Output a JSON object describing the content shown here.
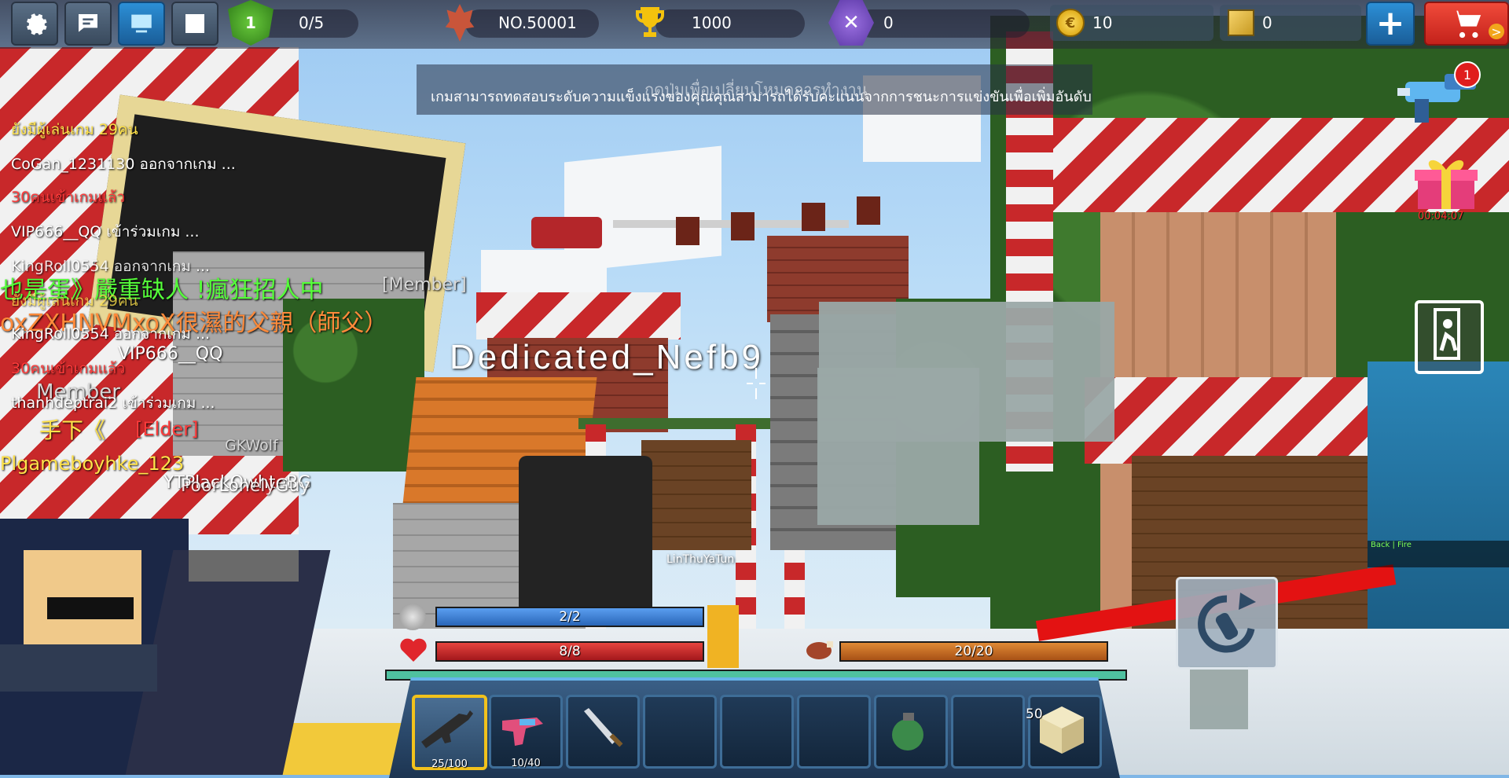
{
  "topbar": {
    "buttons": [
      {
        "name": "settings-button",
        "icon": "gear-icon"
      },
      {
        "name": "chat-button",
        "icon": "chat-bubble-icon"
      },
      {
        "name": "screen-button",
        "icon": "monitor-icon"
      },
      {
        "name": "emote-button",
        "icon": "face-icon"
      }
    ],
    "level": "1",
    "kills": "0/5",
    "rank": "NO.50001",
    "trophies": "1000",
    "tools": "0",
    "gold": "10",
    "cubes": "0",
    "add_icon": "plus-icon",
    "shop_icon": "cart-icon",
    "shop_arrow": ">"
  },
  "banner": {
    "line1": "กดปุ่มเพื่อเปลี่ยนโหมดการทำงาน",
    "line2": "เกมสามารถทดสอบระดับความแข็งแรงของคุณคุณสามารถได้รับคะแนนจากการชนะการแข่งขันเพื่อเพิ่มอันดับ"
  },
  "chat": [
    {
      "text": "ยังมีผู้เล่นเกม 29คน",
      "color": "#ffe24a"
    },
    {
      "text": "CoGan_1231130 ออกจากเกม ...",
      "color": "#ffffff"
    },
    {
      "text": "30คนเข้าเกมแล้ว",
      "color": "#ff3b3b"
    },
    {
      "text": "VIP666__QQ เข้าร่วมเกม ...",
      "color": "#ffffff"
    },
    {
      "text": "KingRoll0554 ออกจากเกม ...",
      "color": "#ffffff"
    },
    {
      "text": "也是蛋》嚴重缺人 !瘋狂招人中",
      "color": "#55ff3a"
    },
    {
      "text": "[Member]",
      "color": "#d8d8d8"
    },
    {
      "text": "ยังมีผู้เล่นเกม 29คน",
      "color": "#ffe24a"
    },
    {
      "text": "oxZXHNVMxoX很濕的父親（師父）",
      "color": "#ff8a3a"
    },
    {
      "text": "KingRoll0554 ออกจากเกม ...",
      "color": "#ffffff"
    },
    {
      "text": "VIP666__QQ",
      "color": "#ffffff"
    },
    {
      "text": "30คนเข้าเกมแล้ว",
      "color": "#ff3b3b"
    },
    {
      "text": "Member",
      "color": "#d8d8d8"
    },
    {
      "text": "thanhdeptrai2 เข้าร่วมเกม ...",
      "color": "#ffffff"
    },
    {
      "text": "手下《",
      "color": "#ffe24a"
    },
    {
      "text": "[Elder]",
      "color": "#ff3b3b"
    },
    {
      "text": "GKWolf",
      "color": "#d8d8d8"
    },
    {
      "text": "Plgameboyhke_123",
      "color": "#ffe24a"
    },
    {
      "text": "YTPlackOwhteBG",
      "color": "#ffffff"
    },
    {
      "text": "PoorLonelyGuy",
      "color": "#ffffff"
    }
  ],
  "players": {
    "main": "Dedicated_Nefb9",
    "far": "LinThuYaTun"
  },
  "side": {
    "gun_badge": "1",
    "gift_timer": "00:04:07",
    "gift_icon": "gift-icon",
    "exit_icon": "exit-door-icon",
    "minimap_text": "Back | Fire"
  },
  "stats": {
    "armor": {
      "label": "2/2",
      "value": 1.0,
      "color": "#3b7fd1"
    },
    "health": {
      "label": "8/8",
      "value": 1.0,
      "color": "#c0282b"
    },
    "food": {
      "label": "20/20",
      "value": 1.0,
      "color": "#c66a22"
    },
    "xp": {
      "value": 1.0,
      "color": "#4fc1a0"
    }
  },
  "hotbar": [
    {
      "name": "slot-rifle",
      "icon": "rifle-icon",
      "ammo": "25/100",
      "selected": true
    },
    {
      "name": "slot-pistol",
      "icon": "pistol-icon",
      "ammo": "10/40",
      "selected": false
    },
    {
      "name": "slot-sword",
      "icon": "sword-icon",
      "ammo": "",
      "selected": false
    },
    {
      "name": "slot-empty-4",
      "icon": "",
      "ammo": "",
      "selected": false
    },
    {
      "name": "slot-empty-5",
      "icon": "",
      "ammo": "",
      "selected": false
    },
    {
      "name": "slot-empty-6",
      "icon": "",
      "ammo": "",
      "selected": false
    },
    {
      "name": "slot-grenade",
      "icon": "grenade-icon",
      "ammo": "",
      "selected": false
    },
    {
      "name": "slot-empty-8",
      "icon": "",
      "ammo": "",
      "selected": false
    },
    {
      "name": "slot-block",
      "icon": "sand-block-icon",
      "count": "50",
      "selected": false
    }
  ],
  "reload_icon": "reload-icon"
}
